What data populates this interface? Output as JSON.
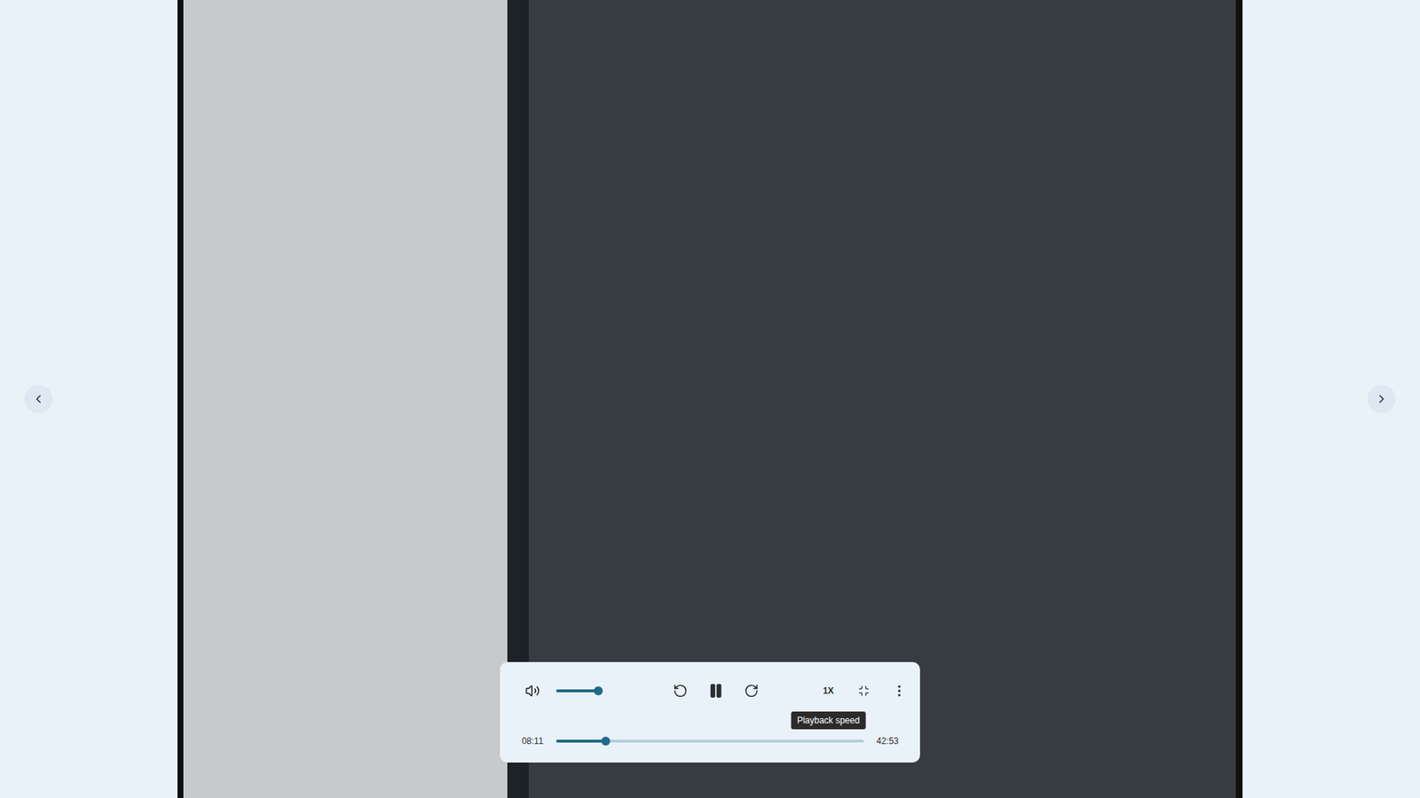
{
  "player": {
    "playing": true,
    "muted": false,
    "volume_level": 0.92,
    "progress_level": 0.162,
    "current_time": "08:11",
    "duration": "42:53",
    "speed": "1X",
    "tooltip": "Playback speed"
  },
  "navigation": {
    "previous": true,
    "next": true
  }
}
